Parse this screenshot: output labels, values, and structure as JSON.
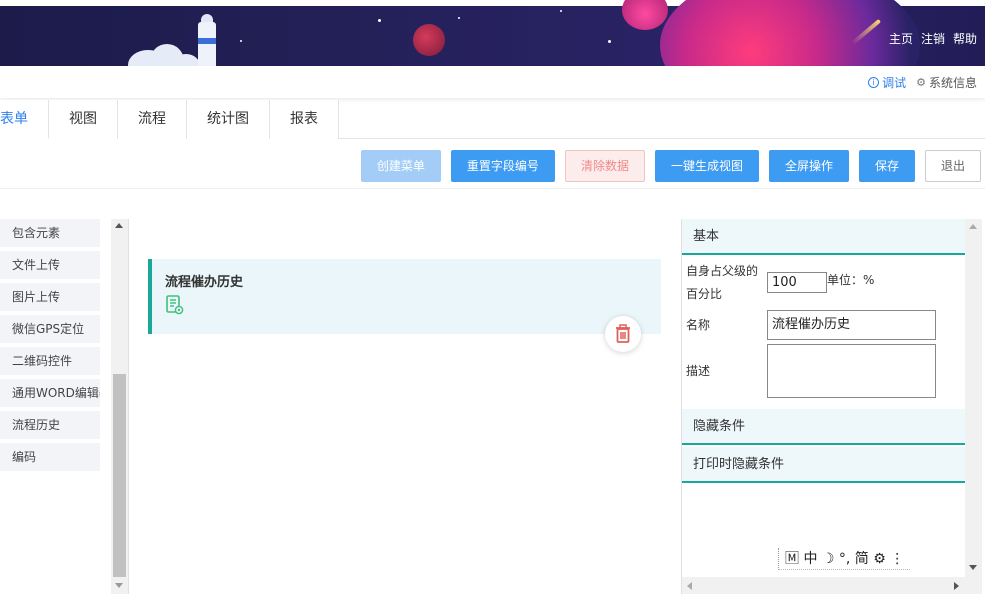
{
  "header": {
    "links": [
      "主页",
      "注销",
      "帮助"
    ]
  },
  "subbar": {
    "debug_label": "调试",
    "sysinfo_label": "系统信息"
  },
  "tabs": [
    {
      "label": "表单",
      "active": true
    },
    {
      "label": "视图",
      "active": false
    },
    {
      "label": "流程",
      "active": false
    },
    {
      "label": "统计图",
      "active": false
    },
    {
      "label": "报表",
      "active": false
    }
  ],
  "toolbar": {
    "create_menu": "创建菜单",
    "reset_field_no": "重置字段编号",
    "clear_data": "清除数据",
    "gen_view": "一键生成视图",
    "fullscreen": "全屏操作",
    "save": "保存",
    "exit": "退出"
  },
  "palette": {
    "items": [
      "包含元素",
      "文件上传",
      "图片上传",
      "微信GPS定位",
      "二维码控件",
      "通用WORD编辑器",
      "流程历史",
      "编码"
    ]
  },
  "canvas": {
    "field_title": "流程催办历史"
  },
  "properties": {
    "basic_section": "基本",
    "percent_label_1": "自身占父级的",
    "percent_label_2": "百分比",
    "percent_value": "100",
    "unit_label": "单位：%",
    "name_label": "名称",
    "name_value": "流程催办历史",
    "desc_label": "描述",
    "desc_value": "",
    "hidden_cond_section": "隐藏条件",
    "print_hidden_section": "打印时隐藏条件"
  },
  "ime_bar": {
    "text": "🄼 中 ☽ °, 简 ⚙ ⋮"
  },
  "colors": {
    "accent": "#2f80ed",
    "primary_button": "#3d9bf2",
    "teal": "#1aa89a",
    "banner": "#1c1b4a"
  }
}
